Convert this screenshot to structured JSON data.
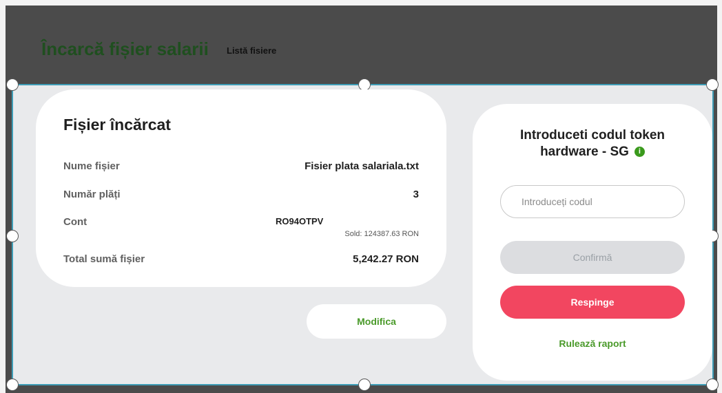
{
  "header": {
    "title": "Încarcă fișier salarii",
    "tab_list": "Listă fisiere"
  },
  "file_card": {
    "title": "Fișier încărcat",
    "rows": {
      "file_name": {
        "label": "Nume fișier",
        "value": "Fisier plata salariala.txt"
      },
      "payments": {
        "label": "Număr plăți",
        "value": "3"
      },
      "account": {
        "label": "Cont",
        "value": "RO94OTPV",
        "balance": "Sold: 124387.63 RON"
      },
      "total": {
        "label": "Total sumă fișier",
        "value": "5,242.27 RON"
      }
    },
    "modify_label": "Modifica"
  },
  "token_card": {
    "title_line1": "Introduceti codul token",
    "title_line2": "hardware - SG",
    "code_placeholder": "Introduceți codul",
    "confirm_label": "Confirmă",
    "reject_label": "Respinge",
    "report_label": "Rulează raport",
    "info_icon": "info-icon"
  },
  "colors": {
    "header_bg": "#4b4b4b",
    "title_green": "#1f4f1f",
    "accent_green": "#4a9a2a",
    "reject_red": "#f24660",
    "selection_border": "#3e9db6"
  }
}
